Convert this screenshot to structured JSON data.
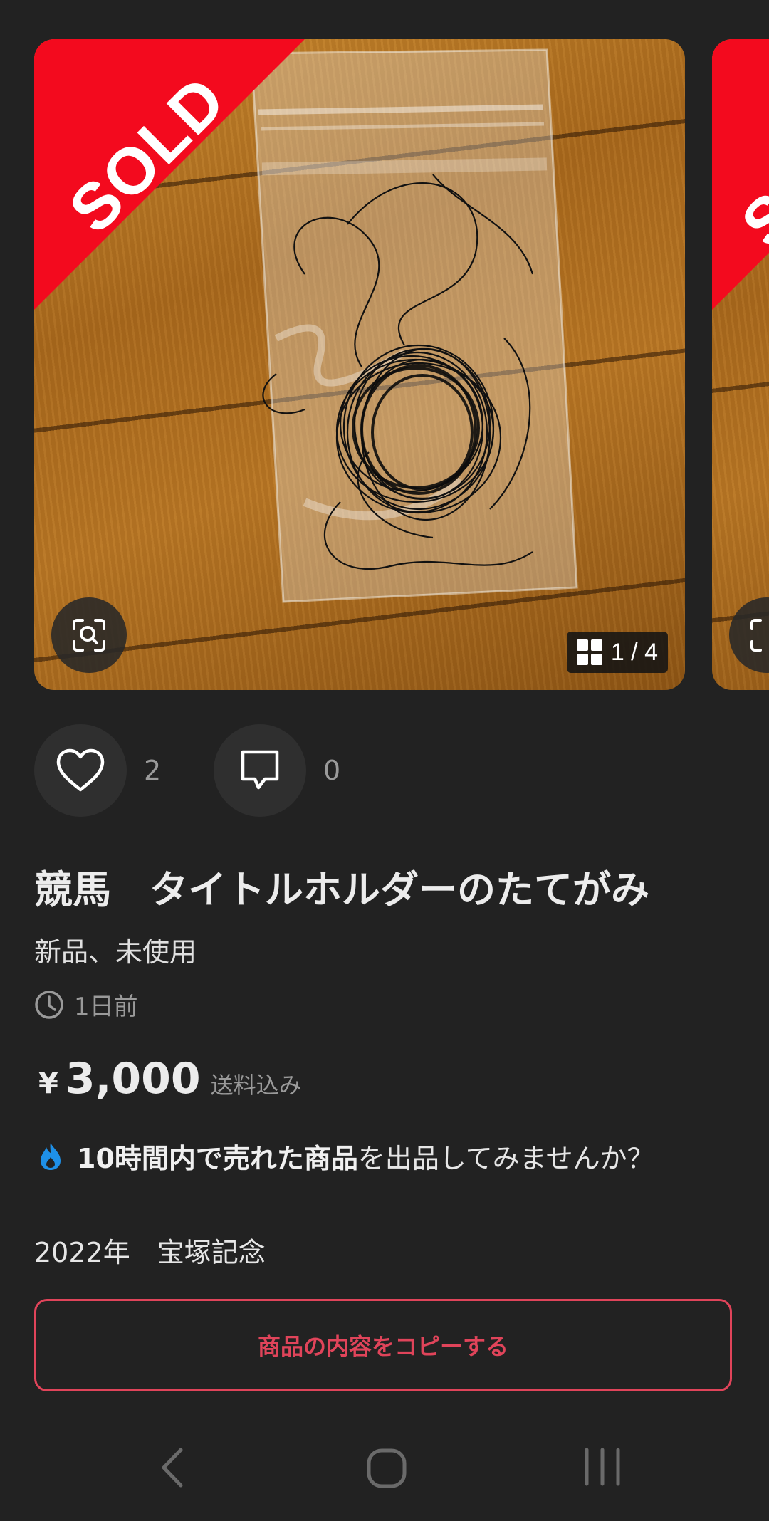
{
  "carousel": {
    "sold_label": "SOLD",
    "counter": "1 / 4",
    "icons": [
      "lens-icon",
      "grid-icon"
    ]
  },
  "actions": {
    "like_count": "2",
    "comment_count": "0"
  },
  "item": {
    "title": "競馬　タイトルホルダーのたてがみ",
    "condition": "新品、未使用",
    "posted": "1日前",
    "currency": "¥",
    "price": "3,000",
    "shipping": "送料込み",
    "description": "2022年　宝塚記念"
  },
  "promo": {
    "bold": "10時間内で売れた商品",
    "rest": "を出品してみませんか？"
  },
  "copy_button": {
    "label": "商品の内容をコピーする"
  },
  "colors": {
    "background": "#222222",
    "sold_red": "#f30a1e",
    "accent": "#e0445a",
    "flame_blue": "#1e90e8"
  }
}
